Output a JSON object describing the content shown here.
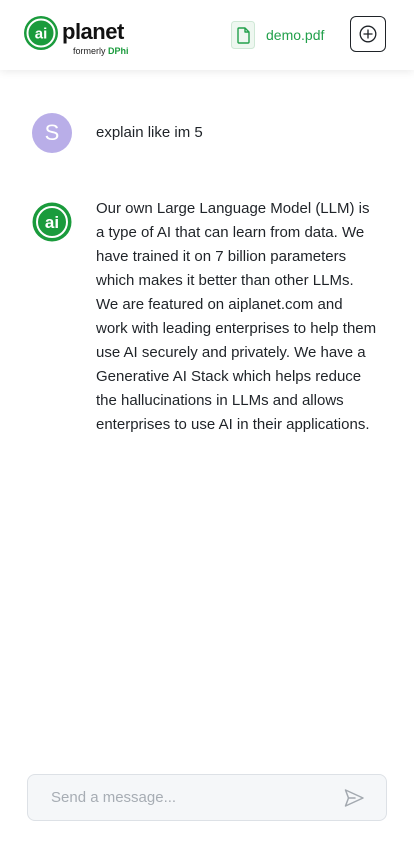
{
  "header": {
    "logo": {
      "mark_text": "ai",
      "word": "planet",
      "sub_prefix": "formerly ",
      "sub_brand": "DPhi"
    },
    "file": {
      "name": "demo.pdf",
      "icon": "file-icon"
    },
    "new_chat_icon": "plus-circle-icon"
  },
  "messages": [
    {
      "role": "user",
      "avatar_initial": "S",
      "text": "explain like im 5"
    },
    {
      "role": "assistant",
      "avatar_text": "ai",
      "text": "Our own Large Language Model (LLM) is a type of AI that can learn from data. We have trained it on 7 billion parameters which makes it better than other LLMs. We are featured on aiplanet.com and work with leading enterprises to help them use AI securely and privately. We have a Generative AI Stack which helps reduce the hallucinations in LLMs and allows enterprises to use AI in their applications."
    }
  ],
  "composer": {
    "placeholder": "Send a message...",
    "value": "",
    "send_icon": "send-icon"
  },
  "colors": {
    "brand_green": "#1a9b3c",
    "user_avatar": "#b9aee8",
    "file_green": "#22a04b"
  }
}
